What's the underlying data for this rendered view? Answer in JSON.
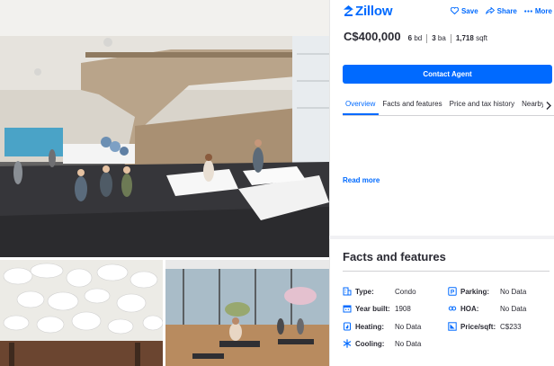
{
  "header": {
    "logo_text": "Zillow",
    "save_label": "Save",
    "share_label": "Share",
    "more_label": "More"
  },
  "summary": {
    "price": "C$400,000",
    "beds_value": "6",
    "beds_unit": "bd",
    "baths_value": "3",
    "baths_unit": "ba",
    "sqft_value": "1,718",
    "sqft_unit": "sqft"
  },
  "contact_button": "Contact Agent",
  "tabs": [
    {
      "label": "Overview",
      "active": true
    },
    {
      "label": "Facts and features",
      "active": false
    },
    {
      "label": "Price and tax history",
      "active": false
    },
    {
      "label": "Nearby",
      "active": false
    }
  ],
  "read_more": "Read more",
  "facts_section": {
    "title": "Facts and features",
    "left": [
      {
        "label": "Type:",
        "value": "Condo",
        "icon": "building-icon"
      },
      {
        "label": "Year built:",
        "value": "1908",
        "icon": "calendar-icon"
      },
      {
        "label": "Heating:",
        "value": "No Data",
        "icon": "flame-icon"
      },
      {
        "label": "Cooling:",
        "value": "No Data",
        "icon": "snowflake-icon"
      }
    ],
    "right": [
      {
        "label": "Parking:",
        "value": "No Data",
        "icon": "parking-icon"
      },
      {
        "label": "HOA:",
        "value": "No Data",
        "icon": "hoa-icon"
      },
      {
        "label": "Price/sqft:",
        "value": "C$233",
        "icon": "price-sqft-icon"
      }
    ]
  },
  "colors": {
    "accent": "#006aff",
    "text": "#2a2a33"
  }
}
